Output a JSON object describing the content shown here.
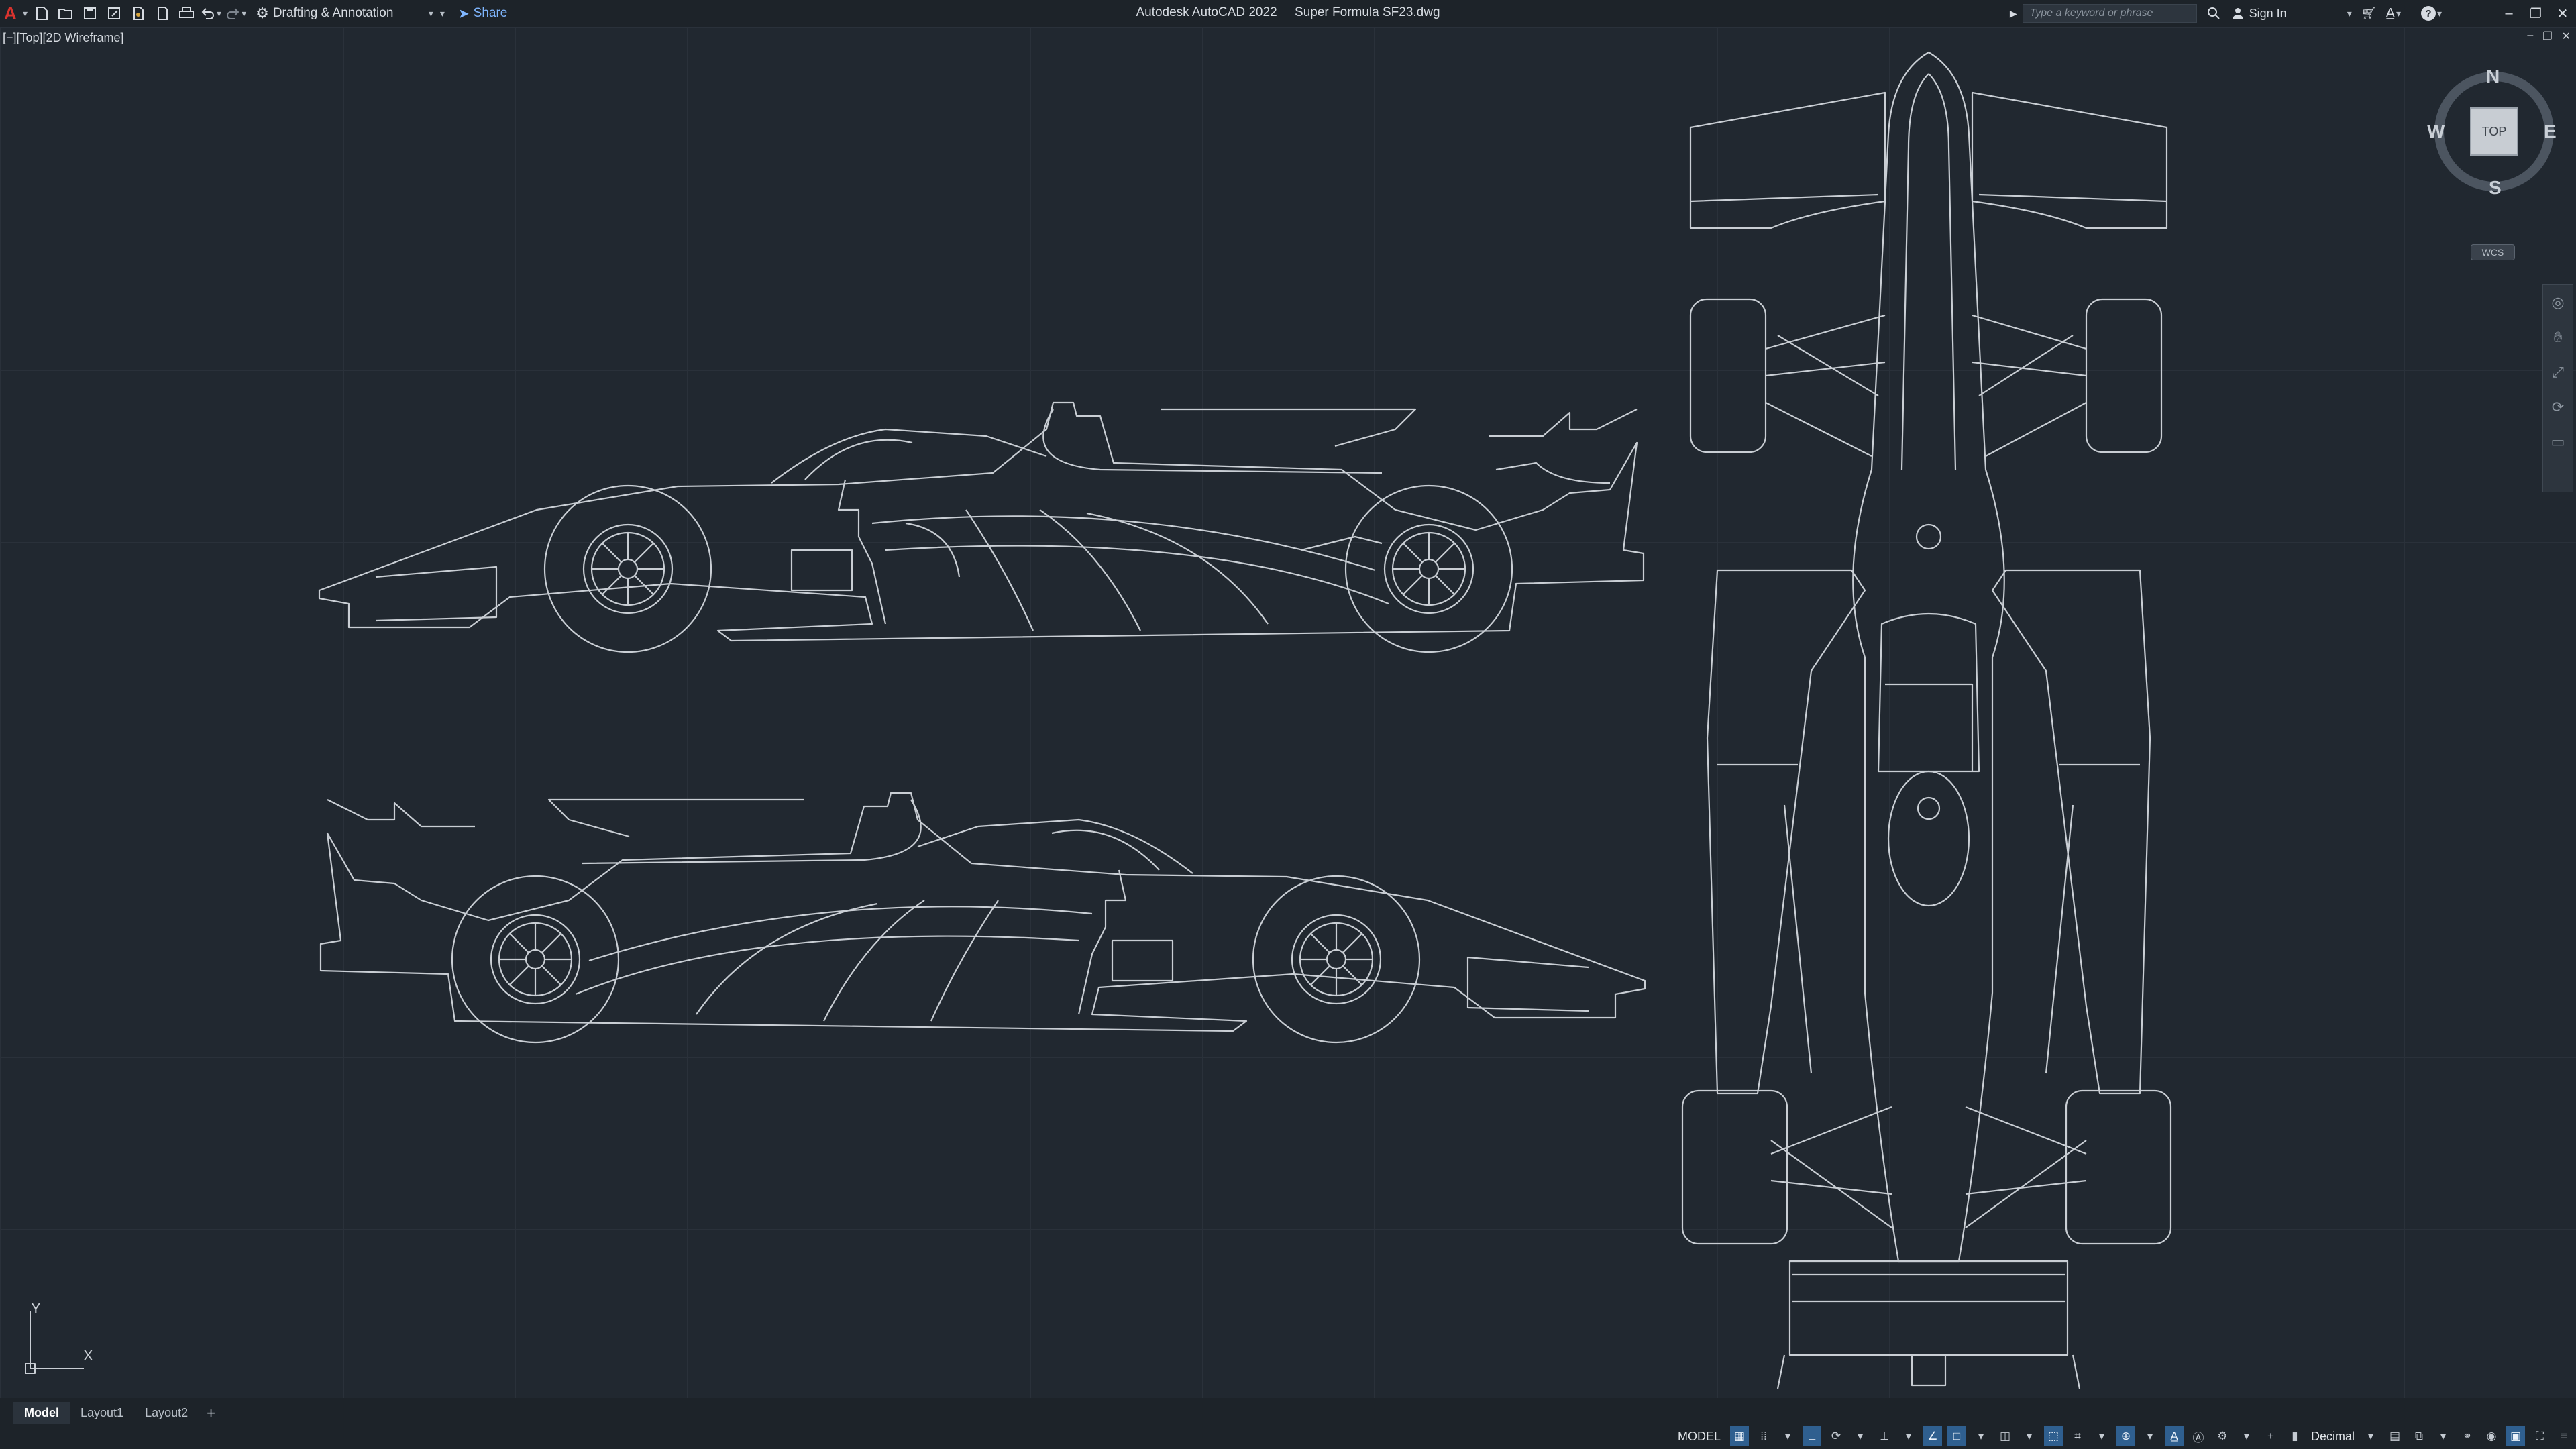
{
  "titlebar": {
    "app_title": "Autodesk AutoCAD 2022",
    "file_name": "Super Formula SF23.dwg",
    "workspace": "Drafting & Annotation",
    "share_label": "Share",
    "search_placeholder": "Type a keyword or phrase",
    "sign_in_label": "Sign In",
    "icons": [
      "autocad-logo-icon",
      "new-icon",
      "open-icon",
      "save-icon",
      "save-as-icon",
      "publish-icon",
      "plot-preview-icon",
      "print-icon",
      "undo-icon",
      "redo-icon",
      "gear-icon",
      "share-icon",
      "search-icon",
      "user-icon",
      "cart-icon",
      "a360-icon",
      "help-icon"
    ]
  },
  "viewport": {
    "label": "[−][Top][2D Wireframe]",
    "ucs": {
      "x_label": "X",
      "y_label": "Y"
    }
  },
  "viewcube": {
    "north": "N",
    "south": "S",
    "east": "E",
    "west": "W",
    "face": "TOP",
    "wcs_label": "WCS"
  },
  "layout_tabs": {
    "items": [
      {
        "label": "Model",
        "active": true
      },
      {
        "label": "Layout1",
        "active": false
      },
      {
        "label": "Layout2",
        "active": false
      }
    ],
    "add_label": "+"
  },
  "statusbar": {
    "model_label": "MODEL",
    "units_label": "Decimal"
  },
  "colors": {
    "background": "#212830",
    "grid": "#2a313a",
    "linework": "#c9ced4",
    "accent": "#2f5f8f",
    "logo": "#d8332e"
  }
}
